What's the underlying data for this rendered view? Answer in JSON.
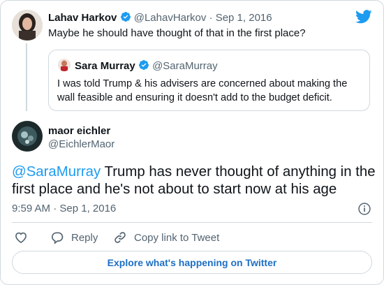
{
  "parent": {
    "name": "Lahav Harkov",
    "handle": "@LahavHarkov",
    "separator": "·",
    "date": "Sep 1, 2016",
    "text": "Maybe he should have thought of that in the first place?"
  },
  "quoted": {
    "name": "Sara Murray",
    "handle": "@SaraMurray",
    "text_line1": "I was told Trump & his advisers are concerned about making the",
    "text_line2": "wall feasible and ensuring it doesn't add to the budget deficit."
  },
  "main": {
    "name": "maor eichler",
    "handle": "@EichlerMaor",
    "mention": "@SaraMurray",
    "text_line1_rest": " Trump has never thought of anything in the",
    "text_line2": "first place and he's not about to start now at his age",
    "timestamp": "9:59 AM · Sep 1, 2016"
  },
  "actions": {
    "reply": "Reply",
    "copy_link": "Copy link to Tweet"
  },
  "explore": "Explore what's happening on Twitter",
  "colors": {
    "twitter_blue": "#1d9bf0",
    "text": "#0f1419",
    "muted": "#536471",
    "border": "#cfd9de"
  }
}
